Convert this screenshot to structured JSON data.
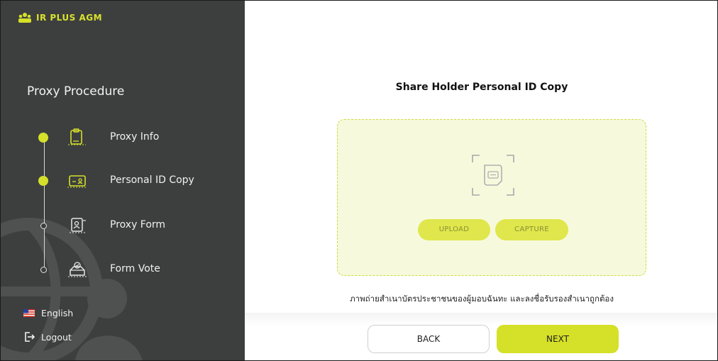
{
  "brand": {
    "name": "IR PLUS AGM",
    "accent": "#d5e028",
    "sidebar_bg": "#3d3f3f"
  },
  "sidebar": {
    "title": "Proxy Procedure",
    "steps": [
      {
        "label": "Proxy Info",
        "icon": "clipboard-icon",
        "status": "done"
      },
      {
        "label": "Personal ID Copy",
        "icon": "id-card-icon",
        "status": "current"
      },
      {
        "label": "Proxy Form",
        "icon": "user-form-icon",
        "status": "pending"
      },
      {
        "label": "Form Vote",
        "icon": "ballot-box-icon",
        "status": "pending"
      }
    ],
    "language": {
      "label": "English",
      "icon": "us-flag-icon"
    },
    "logout": {
      "label": "Logout",
      "icon": "logout-icon"
    }
  },
  "main": {
    "title": "Share Holder Personal ID Copy",
    "upload_label": "UPLOAD",
    "capture_label": "CAPTURE",
    "note": "ภาพถ่ายสำเนาบัตรประชาชนของผู้มอบฉันทะ และลงชื่อรับรองสำเนาถูกต้อง",
    "back_label": "BACK",
    "next_label": "NEXT"
  }
}
